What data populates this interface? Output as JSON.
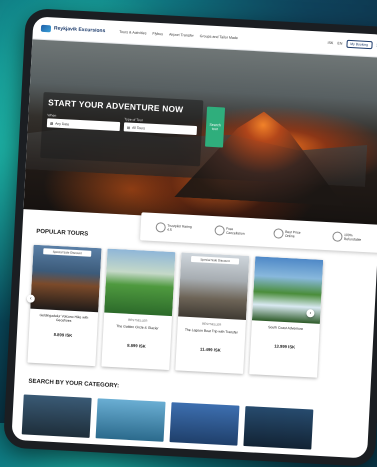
{
  "brand": {
    "name": "Reykjavik Excursions"
  },
  "nav": {
    "links": [
      "Tours & Activities",
      "Flybus",
      "Airport Transfer",
      "Groups and Tailor Made"
    ],
    "currency": "ISK",
    "language": "EN",
    "my_booking": "My Booking"
  },
  "hero": {
    "title": "START YOUR ADVENTURE NOW",
    "fields": [
      {
        "label": "When",
        "value": "Any Date"
      },
      {
        "label": "Type of Tour",
        "value": "All Tours"
      }
    ],
    "search_label": "Search tour"
  },
  "trust": [
    {
      "label": "Trustpilot Rating 4.5"
    },
    {
      "label": "Free Cancellation"
    },
    {
      "label": "Best Price Online"
    },
    {
      "label": "100% Refundable"
    }
  ],
  "popular": {
    "title": "POPULAR TOURS",
    "cards": [
      {
        "badge": "Special Sale Discount",
        "meta": "",
        "name": "Geldingadalur Volcano Hike with Geoshoes",
        "price": "8.899 ISK"
      },
      {
        "badge": "",
        "meta": "BESTSELLER",
        "name": "The Golden Circle & Glacier",
        "price": "8.899 ISK"
      },
      {
        "badge": "Special Sale Discount",
        "meta": "BESTSELLER",
        "name": "The Lagoon Boat Trip with Transfer",
        "price": "11.499 ISK"
      },
      {
        "badge": "",
        "meta": "",
        "name": "South Coast Adventure",
        "price": "13.999 ISK"
      }
    ]
  },
  "categories": {
    "title": "SEARCH BY YOUR CATEGORY:"
  },
  "icons": {
    "prev": "chevron-left-icon",
    "next": "chevron-right-icon"
  }
}
